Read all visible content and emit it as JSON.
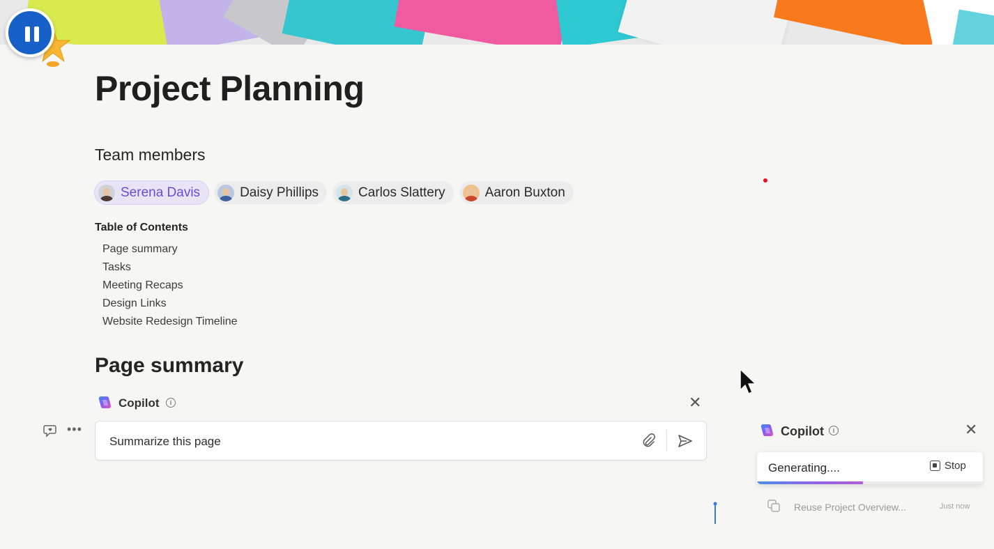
{
  "page": {
    "title": "Project Planning",
    "team_heading": "Team members",
    "members": [
      {
        "name": "Serena Davis",
        "active": true,
        "shirt_color": "#4b3a34"
      },
      {
        "name": "Daisy Phillips",
        "active": false,
        "shirt_color": "#3d5f9a"
      },
      {
        "name": "Carlos Slattery",
        "active": false,
        "shirt_color": "#2f6d8a"
      },
      {
        "name": "Aaron Buxton",
        "active": false,
        "shirt_color": "#c8462d"
      }
    ],
    "toc": {
      "heading": "Table of Contents",
      "items": [
        "Page summary",
        "Tasks",
        "Meeting Recaps",
        "Design Links",
        "Website Redesign Timeline"
      ]
    },
    "summary_heading": "Page summary"
  },
  "inline_copilot": {
    "title": "Copilot",
    "prompt": "Summarize this page"
  },
  "side_copilot": {
    "title": "Copilot",
    "status": "Generating....",
    "stop_label": "Stop",
    "progress": 0.47,
    "recent": {
      "label": "Reuse Project Overview...",
      "time": "Just now"
    }
  },
  "colors": {
    "accent_purple": "#6b4bd6",
    "pause_button": "#1660c7"
  }
}
